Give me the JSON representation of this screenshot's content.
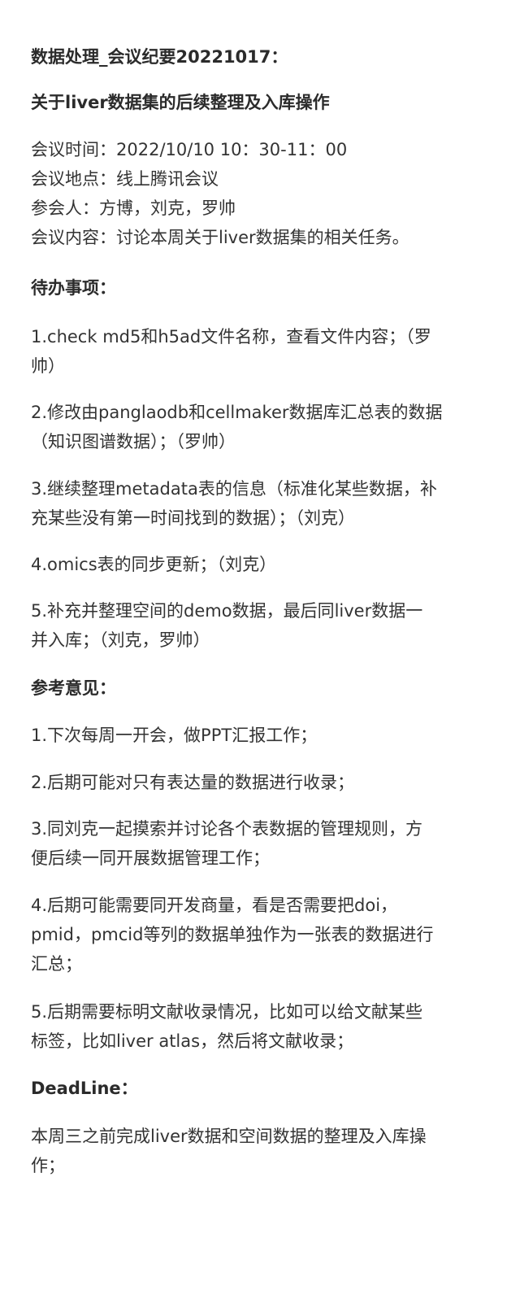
{
  "header": {
    "title": "数据处理_会议纪要20221017：",
    "subtitle": "关于liver数据集的后续整理及入库操作"
  },
  "meta": {
    "time": "会议时间：2022/10/10 10：30-11：00",
    "location": "会议地点：线上腾讯会议",
    "attendees": "参会人：方博，刘克，罗帅",
    "content": "会议内容：讨论本周关于liver数据集的相关任务。"
  },
  "todo": {
    "heading": "待办事项：",
    "items": [
      {
        "line1": "1.check md5和h5ad文件名称，查看文件内容；（罗",
        "line2": "帅）"
      },
      {
        "line1": "2.修改由panglaodb和cellmaker数据库汇总表的数据",
        "line2": "（知识图谱数据）；（罗帅）"
      },
      {
        "line1": "3.继续整理metadata表的信息（标准化某些数据，补",
        "line2": "充某些没有第一时间找到的数据）；（刘克）"
      },
      {
        "line1": "4.omics表的同步更新；（刘克）"
      },
      {
        "line1": "5.补充并整理空间的demo数据，最后同liver数据一",
        "line2": "并入库；（刘克，罗帅）"
      }
    ]
  },
  "advice": {
    "heading": "参考意见：",
    "items": [
      {
        "line1": "1.下次每周一开会，做PPT汇报工作；"
      },
      {
        "line1": "2.后期可能对只有表达量的数据进行收录；"
      },
      {
        "line1": "3.同刘克一起摸索并讨论各个表数据的管理规则，方",
        "line2": "便后续一同开展数据管理工作；"
      },
      {
        "line1": "4.后期可能需要同开发商量，看是否需要把doi，",
        "line2": "pmid，pmcid等列的数据单独作为一张表的数据进行",
        "line3": "汇总；"
      },
      {
        "line1": "5.后期需要标明文献收录情况，比如可以给文献某些",
        "line2": "标签，比如liver atlas，然后将文献收录；"
      }
    ]
  },
  "deadline": {
    "heading": "DeadLine：",
    "line1": "本周三之前完成liver数据和空间数据的整理及入库操",
    "line2": "作；"
  }
}
